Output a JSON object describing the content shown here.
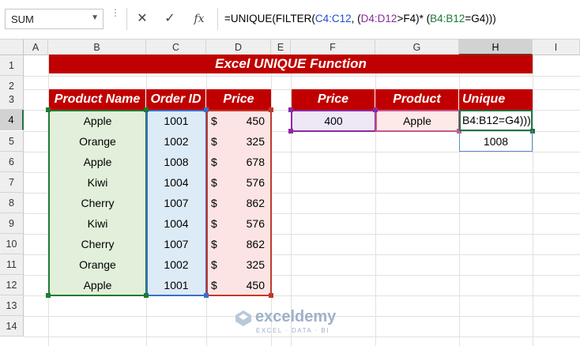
{
  "formula_bar": {
    "name_box": "SUM",
    "cancel_symbol": "✕",
    "enter_symbol": "✓",
    "fx_symbol": "fx",
    "formula": {
      "p1": "=UNIQUE(FILTER(",
      "p2": "C4:C12",
      "p3": ", (",
      "p4": "D4:D12",
      "p5": ">F4)* (",
      "p6": "B4:B12",
      "p7": "=G4)))"
    }
  },
  "columns": [
    "A",
    "B",
    "C",
    "D",
    "E",
    "F",
    "G",
    "H",
    "I"
  ],
  "selected_column": "H",
  "rows": [
    "1",
    "2",
    "3",
    "4",
    "5",
    "6",
    "7",
    "8",
    "9",
    "10",
    "11",
    "12",
    "13",
    "14"
  ],
  "selected_row": "4",
  "sheet": {
    "title": "Excel UNIQUE Function",
    "table": {
      "headers": [
        "Product Name",
        "Order ID",
        "Price"
      ],
      "rows": [
        {
          "product": "Apple",
          "order_id": "1001",
          "price": "450"
        },
        {
          "product": "Orange",
          "order_id": "1002",
          "price": "325"
        },
        {
          "product": "Apple",
          "order_id": "1008",
          "price": "678"
        },
        {
          "product": "Kiwi",
          "order_id": "1004",
          "price": "576"
        },
        {
          "product": "Cherry",
          "order_id": "1007",
          "price": "862"
        },
        {
          "product": "Kiwi",
          "order_id": "1004",
          "price": "576"
        },
        {
          "product": "Cherry",
          "order_id": "1007",
          "price": "862"
        },
        {
          "product": "Orange",
          "order_id": "1002",
          "price": "325"
        },
        {
          "product": "Apple",
          "order_id": "1001",
          "price": "450"
        }
      ],
      "currency_symbol": "$"
    },
    "criteria": {
      "headers": [
        "Price",
        "Product",
        "Unique"
      ],
      "price_value": "400",
      "product_value": "Apple",
      "active_cell_text": "B4:B12=G4)))",
      "spill_value": "1008"
    }
  },
  "watermark": {
    "name": "exceldemy",
    "tagline": "EXCEL · DATA · BI"
  },
  "colors": {
    "header_red": "#c00000",
    "excel_green": "#217346",
    "range_green": "#1e7b34",
    "range_blue": "#3b6fc8",
    "range_red": "#c0392b",
    "range_purple": "#8d2aa0"
  }
}
